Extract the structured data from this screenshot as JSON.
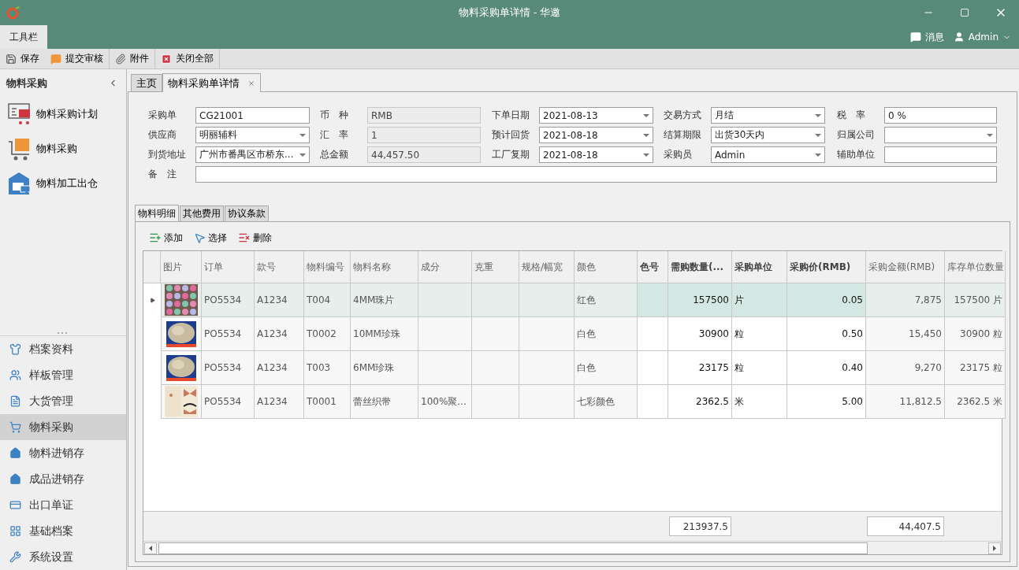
{
  "window": {
    "title": "物料采购单详情 - 华邀"
  },
  "ribbon": {
    "tabs": [
      {
        "label": "工具栏",
        "selected": true
      }
    ],
    "messages": "消息",
    "user": "Admin"
  },
  "toolbar": [
    {
      "label": "保存",
      "separator_after": false
    },
    {
      "label": "提交审核",
      "separator_after": true
    },
    {
      "label": "附件",
      "separator_after": true
    },
    {
      "label": "关闭全部",
      "separator_after": true
    }
  ],
  "sidebar": {
    "title": "物料采购",
    "shortcuts": [
      {
        "label": "物料采购计划"
      },
      {
        "label": "物料采购"
      },
      {
        "label": "物料加工出仓"
      }
    ],
    "nav": [
      {
        "label": "档案资料",
        "selected": false
      },
      {
        "label": "样板管理",
        "selected": false
      },
      {
        "label": "大货管理",
        "selected": false
      },
      {
        "label": "物料采购",
        "selected": true
      },
      {
        "label": "物料进销存",
        "selected": false
      },
      {
        "label": "成品进销存",
        "selected": false
      },
      {
        "label": "出口单证",
        "selected": false
      },
      {
        "label": "基础档案",
        "selected": false
      },
      {
        "label": "系统设置",
        "selected": false
      }
    ]
  },
  "doc_tabs": [
    {
      "label": "主页",
      "selected": false,
      "closable": false
    },
    {
      "label": "物料采购单详情",
      "selected": true,
      "closable": true
    }
  ],
  "form": {
    "fields": [
      {
        "label": "采购单",
        "value": "CG21001",
        "kind": "text"
      },
      {
        "label": "币　种",
        "value": "RMB",
        "kind": "readonly"
      },
      {
        "label": "下单日期",
        "value": "2021-08-13",
        "kind": "select"
      },
      {
        "label": "交易方式",
        "value": "月结",
        "kind": "select"
      },
      {
        "label": "税　率",
        "value": "0 %",
        "kind": "text"
      },
      {
        "label": "供应商",
        "value": "明丽辅料",
        "kind": "select"
      },
      {
        "label": "汇　率",
        "value": "1",
        "kind": "readonly"
      },
      {
        "label": "预计回货",
        "value": "2021-08-18",
        "kind": "select"
      },
      {
        "label": "结算期限",
        "value": "出货30天内",
        "kind": "select"
      },
      {
        "label": "归属公司",
        "kind": "select"
      },
      {
        "label": "到货地址",
        "value": "广州市番禺区市桥东...",
        "kind": "select"
      },
      {
        "label": "总金额",
        "value": "44,457.50",
        "kind": "readonly"
      },
      {
        "label": "工厂复期",
        "value": "2021-08-18",
        "kind": "select"
      },
      {
        "label": "采购员",
        "value": "Admin",
        "kind": "select"
      },
      {
        "label": "辅助单位",
        "kind": "text"
      }
    ],
    "remark": {
      "label": "备　注"
    }
  },
  "detail_tabs": [
    {
      "label": "物料明细",
      "selected": true
    },
    {
      "label": "其他费用",
      "selected": false
    },
    {
      "label": "协议条款",
      "selected": false
    }
  ],
  "grid_toolbar": [
    {
      "label": "添加"
    },
    {
      "label": "选择"
    },
    {
      "label": "删除"
    }
  ],
  "table": {
    "columns": [
      {
        "label": "图片",
        "editable": false
      },
      {
        "label": "订单",
        "editable": false
      },
      {
        "label": "款号",
        "editable": false
      },
      {
        "label": "物料编号",
        "editable": false
      },
      {
        "label": "物料名称",
        "editable": false
      },
      {
        "label": "成分",
        "editable": false
      },
      {
        "label": "克重",
        "editable": false
      },
      {
        "label": "规格/幅宽",
        "editable": false
      },
      {
        "label": "颜色",
        "editable": false
      },
      {
        "label": "色号",
        "editable": true
      },
      {
        "label": "需购数量(...",
        "editable": true,
        "total": "213937.5"
      },
      {
        "label": "采购单位",
        "editable": true
      },
      {
        "label": "采购价(RMB)",
        "editable": true
      },
      {
        "label": "采购金额(RMB)",
        "editable": false,
        "total": "44,407.5"
      },
      {
        "label": "库存单位数量",
        "editable": false
      }
    ],
    "rows": [
      {
        "selected": true,
        "cells": [
          "",
          "PO5534",
          "A1234",
          "T004",
          "4MM珠片",
          null,
          null,
          null,
          "红色",
          null,
          "157500",
          "片",
          "0.05",
          "7,875",
          "157500 片"
        ]
      },
      {
        "selected": false,
        "cells": [
          "",
          "PO5534",
          "A1234",
          "T0002",
          "10MM珍珠",
          null,
          null,
          null,
          "白色",
          null,
          "30900",
          "粒",
          "0.50",
          "15,450",
          "30900 粒"
        ]
      },
      {
        "selected": false,
        "cells": [
          "",
          "PO5534",
          "A1234",
          "T003",
          "6MM珍珠",
          null,
          null,
          null,
          "白色",
          null,
          "23175",
          "粒",
          "0.40",
          "9,270",
          "23175 粒"
        ]
      },
      {
        "selected": false,
        "cells": [
          "",
          "PO5534",
          "A1234",
          "T0001",
          "蕾丝织带",
          "100%聚...",
          null,
          null,
          "七彩颜色",
          null,
          "2362.5",
          "米",
          "5.00",
          "11,812.5",
          "2362.5 米"
        ]
      }
    ]
  }
}
